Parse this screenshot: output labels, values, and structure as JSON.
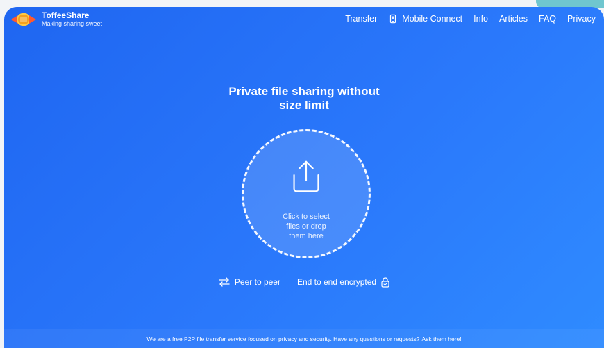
{
  "app": {
    "brand_title": "ToffeeShare",
    "brand_subtitle": "Making sharing sweet"
  },
  "nav": {
    "items": [
      {
        "label": "Transfer",
        "icon": ""
      },
      {
        "label": "Mobile Connect",
        "icon": "phone-icon"
      },
      {
        "label": "Info",
        "icon": ""
      },
      {
        "label": "Articles",
        "icon": ""
      },
      {
        "label": "FAQ",
        "icon": ""
      },
      {
        "label": "Privacy",
        "icon": ""
      }
    ]
  },
  "hero": {
    "line1": "Private file sharing without",
    "line2": "size limit"
  },
  "dropzone": {
    "line1": "Click to select",
    "line2": "files or drop",
    "line3": "them here",
    "icon": "upload-icon"
  },
  "features": {
    "peer_label": "Peer to peer",
    "peer_icon": "arrows-exchange-icon",
    "encrypted_label": "End to end encrypted",
    "encrypted_icon": "lock-icon"
  },
  "footer": {
    "text": "We are a free P2P file transfer service focused on privacy and security. Have any questions or requests?",
    "link_text": "Ask them here!"
  },
  "colors": {
    "background": "#1f66f1",
    "accent_teal": "#6fc6cf"
  }
}
